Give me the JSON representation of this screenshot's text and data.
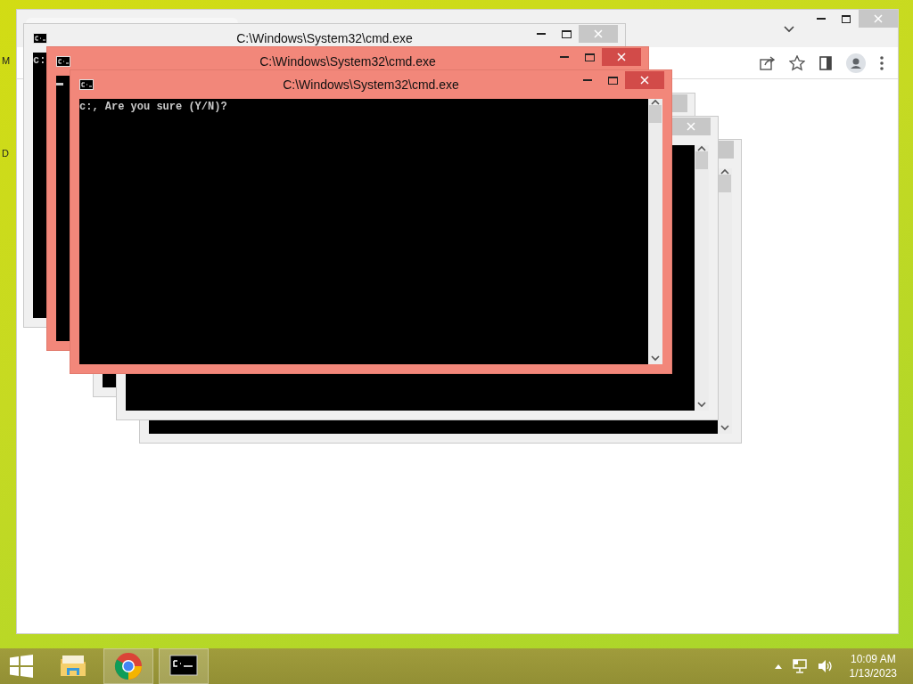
{
  "desktop_fragments": [
    {
      "text": "M"
    },
    {
      "text": "D"
    }
  ],
  "console_windows": [
    {
      "focused": false
    },
    {
      "focused": false
    },
    {
      "focused": false
    },
    {
      "title": "C:\\Windows\\System32\\cmd.exe",
      "focused": false,
      "output": "c:"
    },
    {
      "title": "C:\\Windows\\System32\\cmd.exe",
      "focused": true,
      "cursor": true
    },
    {
      "title": "C:\\Windows\\System32\\cmd.exe",
      "focused": true,
      "output": "c:, Are you sure (Y/N)?"
    }
  ],
  "taskbar": {
    "apps": [
      {
        "kind": "explorer",
        "running": false
      },
      {
        "kind": "chrome",
        "running": true
      },
      {
        "kind": "console",
        "running": true
      }
    ],
    "clock": {
      "time": "10:09 AM",
      "date": "1/13/2023"
    }
  }
}
